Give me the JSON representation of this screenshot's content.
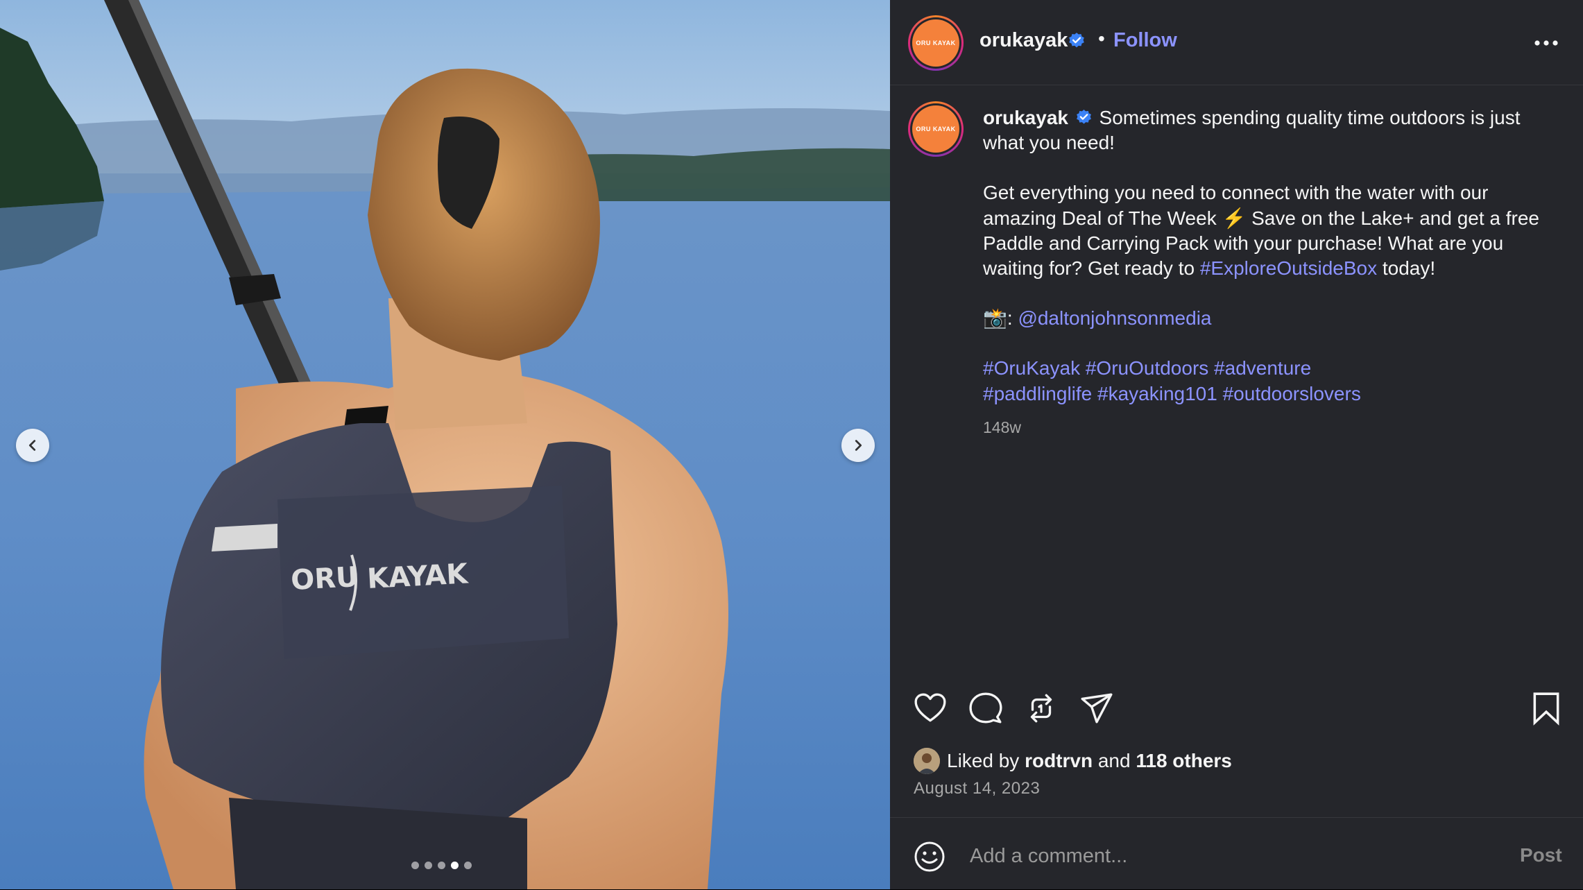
{
  "photo": {
    "vest_brand_left": "ORU",
    "vest_brand_right": "KAYAK",
    "carousel": {
      "total_slides": 5,
      "active_index": 3
    }
  },
  "header": {
    "username": "orukayak",
    "separator": "•",
    "follow_label": "Follow",
    "avatar_logo_text": "ORU KAYAK"
  },
  "caption": {
    "username": "orukayak",
    "line1": "Sometimes spending quality time outdoors is just what you need!",
    "para2_before": "Get everything you need to connect with the water with our amazing Deal of The Week ⚡ Save on the Lake+ and get a free Paddle and Carrying Pack with your purchase! What are you waiting for? Get ready to ",
    "para2_link": "#ExploreOutsideBox",
    "para2_after": " today!",
    "credit_emoji": "📸",
    "credit_sep": ": ",
    "credit_handle": "@daltonjohnsonmedia",
    "hashtags_line1": "#OruKayak #OruOutdoors #adventure",
    "hashtags_line2": "#paddlinglife #kayaking101 #outdoorslovers",
    "age": "148w"
  },
  "likes": {
    "prefix": "Liked by",
    "liker": "rodtrvn",
    "middle": "and",
    "others": "118 others"
  },
  "date": "August 14, 2023",
  "comment": {
    "placeholder": "Add a comment...",
    "post_label": "Post"
  },
  "colors": {
    "panel_bg": "#25262b",
    "link": "#8c93ff",
    "verified": "#3b82f6",
    "brand_orange": "#f4813b"
  },
  "icons": [
    "chevron-left-icon",
    "chevron-right-icon",
    "verified-badge-icon",
    "more-icon",
    "heart-icon",
    "comment-icon",
    "repost-icon",
    "share-icon",
    "bookmark-icon",
    "emoji-icon"
  ]
}
